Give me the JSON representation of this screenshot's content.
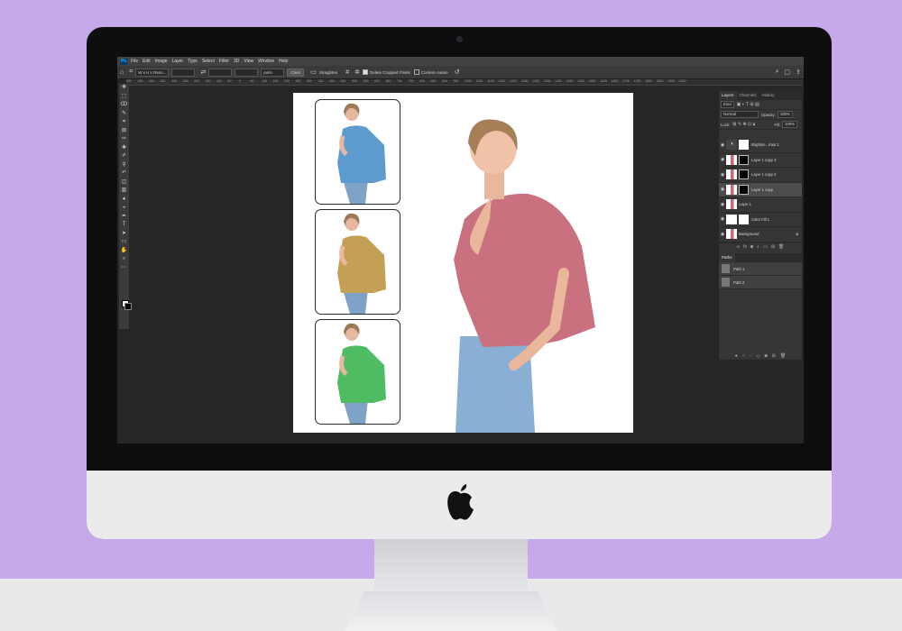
{
  "colors": {
    "wall": "#c6a9ea",
    "desk": "#e9e9eb",
    "ps_dark": "#262626",
    "ps_panel": "#353535"
  },
  "app": {
    "badge": "Ps"
  },
  "menu": [
    "File",
    "Edit",
    "Image",
    "Layer",
    "Type",
    "Select",
    "Filter",
    "3D",
    "View",
    "Window",
    "Help"
  ],
  "options": {
    "ratio": "W x H x Reso...",
    "units": "px/in",
    "clear": "Clear",
    "straighten": "Straighten",
    "delete_cropped": "Delete Cropped Pixels",
    "content_aware": "Content-Aware"
  },
  "ruler_ticks": [
    "500",
    "450",
    "400",
    "350",
    "300",
    "250",
    "200",
    "150",
    "100",
    "50",
    "0",
    "50",
    "100",
    "150",
    "200",
    "250",
    "300",
    "350",
    "400",
    "450",
    "500",
    "550",
    "600",
    "650",
    "700",
    "750",
    "800",
    "850",
    "900",
    "950",
    "1000",
    "1050",
    "1100",
    "1150",
    "1200",
    "1250",
    "1300",
    "1350",
    "1400",
    "1450",
    "1500",
    "1550",
    "1600",
    "1650",
    "1700",
    "1750",
    "1800",
    "1850",
    "1900",
    "1950"
  ],
  "tools": [
    "move-icon",
    "marquee-icon",
    "lasso-icon",
    "quick-select-icon",
    "crop-icon",
    "frame-icon",
    "eyedropper-icon",
    "healing-icon",
    "brush-icon",
    "stamp-icon",
    "history-brush-icon",
    "eraser-icon",
    "gradient-icon",
    "blur-icon",
    "dodge-icon",
    "pen-icon",
    "type-icon",
    "path-select-icon",
    "shape-icon",
    "hand-icon",
    "zoom-icon",
    "more-icon"
  ],
  "layers_panel": {
    "tabs": [
      "Layers",
      "Channels",
      "History"
    ],
    "filter": "Kind",
    "blend_mode": "Normal",
    "opacity_label": "Opacity:",
    "opacity": "100%",
    "lock_label": "Lock:",
    "fill_label": "Fill:",
    "fill": "100%",
    "layers": [
      {
        "name": "Brightne...trast 1"
      },
      {
        "name": "Layer 1 copy 3"
      },
      {
        "name": "Layer 1 copy 2"
      },
      {
        "name": "Layer 1 copy"
      },
      {
        "name": "Layer 1"
      },
      {
        "name": "Color Fill 1"
      },
      {
        "name": "Background"
      }
    ]
  },
  "paths_panel": {
    "tab": "Paths",
    "paths": [
      {
        "name": "Path 1"
      },
      {
        "name": "Path 2"
      }
    ]
  }
}
